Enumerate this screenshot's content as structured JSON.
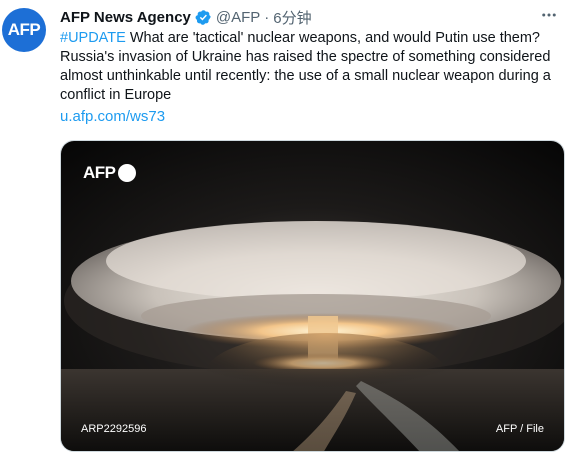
{
  "tweet": {
    "avatar_text": "AFP",
    "author_name": "AFP News Agency",
    "handle": "@AFP",
    "separator": "·",
    "time": "6分钟",
    "hashtag": "#UPDATE",
    "text_rest": " What are 'tactical' nuclear weapons, and would Putin use them? Russia's invasion of Ukraine has raised the spectre of something considered almost unthinkable until recently: the use of a small nuclear weapon during a conflict in Europe",
    "link": "u.afp.com/ws73"
  },
  "media": {
    "logo_text": "AFP",
    "caption_left": "ARP2292596",
    "caption_right": "AFP / File"
  },
  "colors": {
    "link": "#1d9bf0",
    "verified": "#1d9bf0",
    "avatar_bg": "#1d6fd6",
    "meta": "#536471"
  },
  "icons": [
    "verified-badge-icon",
    "more-options-icon"
  ]
}
